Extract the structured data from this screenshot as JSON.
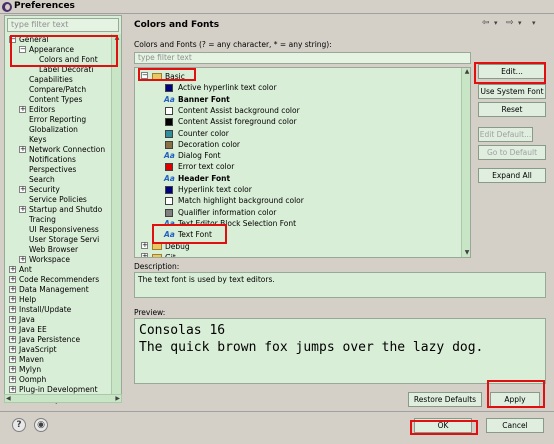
{
  "window": {
    "title": "Preferences"
  },
  "left": {
    "filter_placeholder": "type filter text",
    "tree": [
      {
        "label": "General",
        "toggle": "−"
      },
      {
        "label": "Appearance",
        "toggle": "−"
      },
      {
        "label": "Colors and Font",
        "toggle": ""
      },
      {
        "label": "Label Decorati",
        "toggle": ""
      },
      {
        "label": "Capabilities",
        "toggle": ""
      },
      {
        "label": "Compare/Patch",
        "toggle": ""
      },
      {
        "label": "Content Types",
        "toggle": ""
      },
      {
        "label": "Editors",
        "toggle": "+"
      },
      {
        "label": "Error Reporting",
        "toggle": ""
      },
      {
        "label": "Globalization",
        "toggle": ""
      },
      {
        "label": "Keys",
        "toggle": ""
      },
      {
        "label": "Network Connection",
        "toggle": "+"
      },
      {
        "label": "Notifications",
        "toggle": ""
      },
      {
        "label": "Perspectives",
        "toggle": ""
      },
      {
        "label": "Search",
        "toggle": ""
      },
      {
        "label": "Security",
        "toggle": "+"
      },
      {
        "label": "Service Policies",
        "toggle": ""
      },
      {
        "label": "Startup and Shutdo",
        "toggle": "+"
      },
      {
        "label": "Tracing",
        "toggle": ""
      },
      {
        "label": "UI Responsiveness",
        "toggle": ""
      },
      {
        "label": "User Storage Servi",
        "toggle": ""
      },
      {
        "label": "Web Browser",
        "toggle": ""
      },
      {
        "label": "Workspace",
        "toggle": "+"
      },
      {
        "label": "Ant",
        "toggle": "+"
      },
      {
        "label": "Code Recommenders",
        "toggle": "+"
      },
      {
        "label": "Data Management",
        "toggle": "+"
      },
      {
        "label": "Help",
        "toggle": "+"
      },
      {
        "label": "Install/Update",
        "toggle": "+"
      },
      {
        "label": "Java",
        "toggle": "+"
      },
      {
        "label": "Java EE",
        "toggle": "+"
      },
      {
        "label": "Java Persistence",
        "toggle": "+"
      },
      {
        "label": "JavaScript",
        "toggle": "+"
      },
      {
        "label": "Maven",
        "toggle": "+"
      },
      {
        "label": "Mylyn",
        "toggle": "+"
      },
      {
        "label": "Oomph",
        "toggle": "+"
      },
      {
        "label": "Plug-in Development",
        "toggle": "+"
      },
      {
        "label": "Remote Systems",
        "toggle": "+"
      }
    ]
  },
  "page": {
    "title": "Colors and Fonts",
    "hint": "Colors and Fonts (? = any character, * = any string):",
    "filter_placeholder": "type filter text",
    "tree": [
      {
        "label": "Basic",
        "kind": "folder",
        "toggle": "−"
      },
      {
        "label": "Active hyperlink text color",
        "kind": "color",
        "color": "#000080"
      },
      {
        "label": "Banner Font",
        "kind": "font"
      },
      {
        "label": "Content Assist background color",
        "kind": "color",
        "color": "#ffffff"
      },
      {
        "label": "Content Assist foreground color",
        "kind": "color",
        "color": "#000000"
      },
      {
        "label": "Counter color",
        "kind": "color",
        "color": "#2f8fa0"
      },
      {
        "label": "Decoration color",
        "kind": "color",
        "color": "#8b6f47"
      },
      {
        "label": "Dialog Font",
        "kind": "font"
      },
      {
        "label": "Error text color",
        "kind": "color",
        "color": "#e00000"
      },
      {
        "label": "Header Font",
        "kind": "font"
      },
      {
        "label": "Hyperlink text color",
        "kind": "color",
        "color": "#000080"
      },
      {
        "label": "Match highlight background color",
        "kind": "color",
        "color": "#ffffff"
      },
      {
        "label": "Qualifier information color",
        "kind": "color",
        "color": "#808080"
      },
      {
        "label": "Text Editor Block Selection Font",
        "kind": "font"
      },
      {
        "label": "Text Font",
        "kind": "font"
      },
      {
        "label": "Debug",
        "kind": "folder",
        "toggle": "+"
      },
      {
        "label": "Git",
        "kind": "folder",
        "toggle": "+"
      }
    ],
    "font_icon": "Aa",
    "buttons": {
      "edit": "Edit...",
      "use_system_font": "Use System Font",
      "reset": "Reset",
      "edit_default": "Edit Default...",
      "go_to_default": "Go to Default",
      "expand_all": "Expand All"
    },
    "description_label": "Description:",
    "description": "The text font is used by text editors.",
    "preview_label": "Preview:",
    "preview_lines": [
      "Consolas 16",
      "The quick brown fox jumps over the lazy dog."
    ],
    "restore_defaults": "Restore Defaults",
    "apply": "Apply"
  },
  "footer": {
    "ok": "OK",
    "cancel": "Cancel"
  },
  "colors": {
    "panel_bg": "#d9eed7",
    "highlight": "#e01010",
    "link": "#2060c0"
  }
}
